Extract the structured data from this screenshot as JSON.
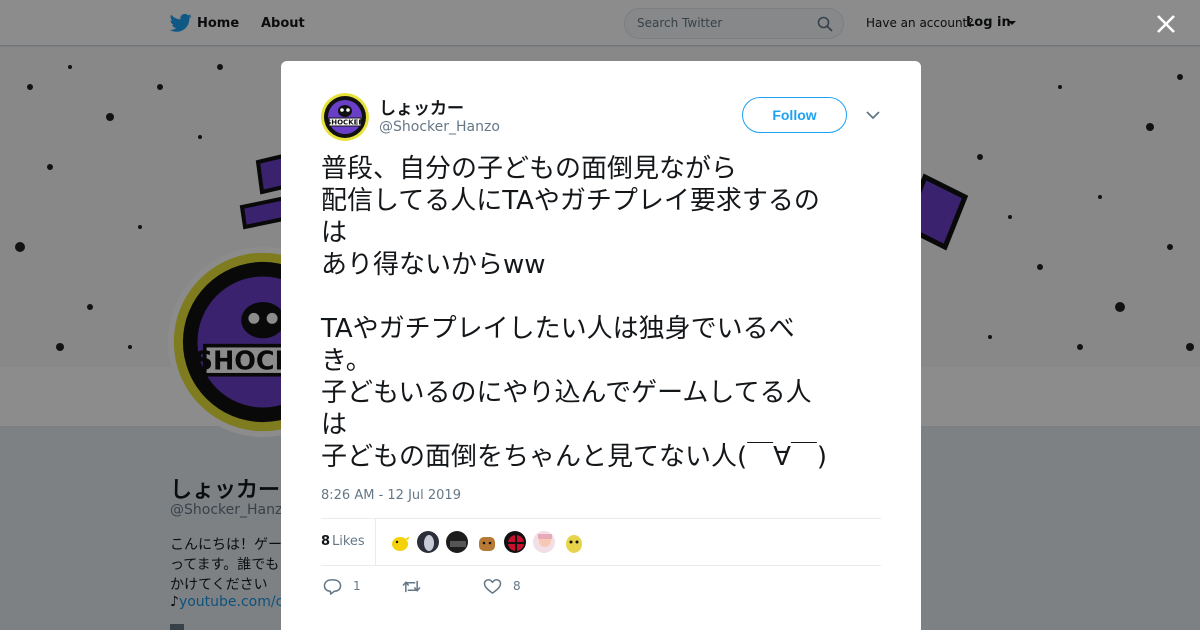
{
  "topbar": {
    "home": "Home",
    "about": "About",
    "search_placeholder": "Search Twitter",
    "have_account": "Have an account?",
    "login": "Log in"
  },
  "profile": {
    "name": "しょッカー",
    "handle": "@Shocker_Hanzo",
    "bio_line1": "こんにちは！ゲー",
    "bio_line2": "ってます。誰でも",
    "bio_line3": "かけてください",
    "link_prefix": "♪",
    "link_text": "youtube.com/cha"
  },
  "tweet": {
    "name": "しょッカー",
    "handle": "@Shocker_Hanzo",
    "follow_label": "Follow",
    "text_lines": [
      "普段、自分の子どもの面倒見ながら",
      "配信してる人にTAやガチプレイ要求するの",
      "は",
      "あり得ないからww",
      "",
      "TAやガチプレイしたい人は独身でいるべ",
      "き。",
      "子どもいるのにやり込んでゲームしてる人",
      "は",
      "子どもの面倒をちゃんと見てない人(￣∀￣)"
    ],
    "timestamp": "8:26 AM - 12 Jul 2019",
    "likes_count": "8",
    "likes_label": "Likes",
    "reply_count": "1",
    "retweet_count": "",
    "like_count": "8"
  },
  "colors": {
    "accent": "#1da1f2",
    "shocker_purple": "#6a3fc8",
    "shocker_yellow": "#e6e23a",
    "text": "#14171a",
    "muted": "#657786"
  },
  "icons": [
    "twitter-bird-icon",
    "search-icon",
    "close-icon",
    "chevron-down-icon",
    "reply-icon",
    "retweet-icon",
    "heart-icon"
  ]
}
